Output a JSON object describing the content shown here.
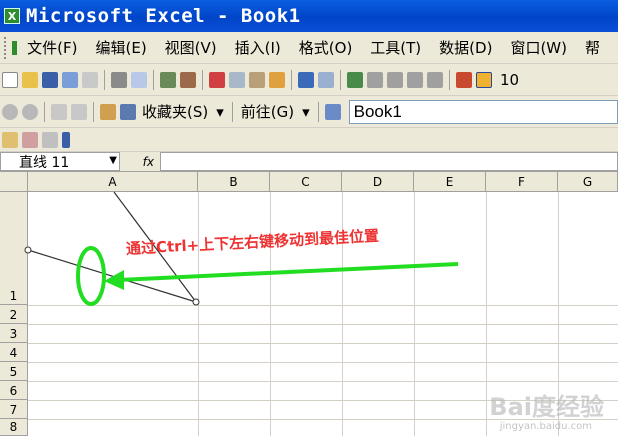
{
  "window": {
    "title": "Microsoft Excel - Book1",
    "app_icon": "excel-icon"
  },
  "menu": {
    "items": [
      "文件(F)",
      "编辑(E)",
      "视图(V)",
      "插入(I)",
      "格式(O)",
      "工具(T)",
      "数据(D)",
      "窗口(W)",
      "帮"
    ]
  },
  "toolbar": {
    "zoom": "10"
  },
  "web_toolbar": {
    "favorites": "收藏夹(S)",
    "go": "前往(G)",
    "address": "Book1"
  },
  "formula_bar": {
    "name_box": "直线 11",
    "fx": "fx"
  },
  "sheet": {
    "columns": [
      "A",
      "B",
      "C",
      "D",
      "E",
      "F",
      "G"
    ],
    "rows": [
      "1",
      "2",
      "3",
      "4",
      "5",
      "6",
      "7",
      "8"
    ]
  },
  "annotation": {
    "text": "通过Ctrl+上下左右键移动到最佳位置",
    "color": "#e33333",
    "circle_color": "#22dd22",
    "arrow_color": "#22dd22"
  },
  "watermark": {
    "text": "Bai度经验",
    "sub": "jingyan.baidu.com"
  }
}
